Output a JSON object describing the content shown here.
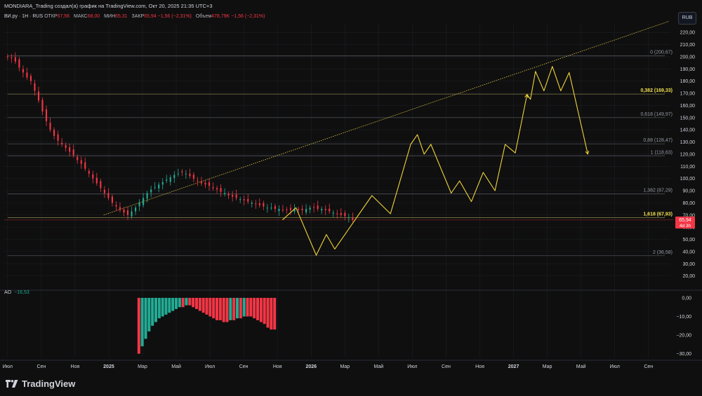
{
  "header": {
    "title": "MONDIARA_Trading создал(а) график на TradingView.com, Окт 20, 2025 21:35 UTC+3",
    "symbol": "ВИ.ру · 1Н · RUS",
    "open_label": "ОТКР",
    "open_value": "67,56",
    "high_label": "МАКС",
    "high_value": "68,00",
    "low_label": "МИН",
    "low_value": "65,31",
    "close_label": "ЗАКР",
    "close_value": "65,94 −1,56 (−2,31%)",
    "volume_label": "Объем",
    "volume_value": "478,79K −1,56 (−2,31%)"
  },
  "currency": "RUB",
  "price_tag": {
    "value": "65,94",
    "countdown": "4d 3h"
  },
  "ao": {
    "label": "AO",
    "value": "−16,53"
  },
  "footer": {
    "brand": "TradingView"
  },
  "colors": {
    "up": "#22ab94",
    "down": "#f23645",
    "projection": "#f0d43a",
    "background": "#0f0f0f"
  },
  "chart_data": {
    "type": "candlestick",
    "price_axis": {
      "ylim": [
        10,
        227
      ],
      "ticks": [
        220,
        210,
        200,
        190,
        180,
        170,
        160,
        150,
        140,
        130,
        120,
        110,
        100,
        90,
        80,
        70,
        60,
        50,
        40,
        30,
        20
      ],
      "tick_labels": [
        "220,00",
        "210,00",
        "200,00",
        "190,00",
        "180,00",
        "170,00",
        "160,00",
        "150,00",
        "140,00",
        "130,00",
        "120,00",
        "110,00",
        "100,00",
        "90,00",
        "80,00",
        "70,00",
        "60,00",
        "50,00",
        "40,00",
        "30,00",
        "20,00"
      ]
    },
    "time_axis": {
      "labels": [
        "Июл",
        "Сен",
        "Ноя",
        "2025",
        "Мар",
        "Май",
        "Июл",
        "Сен",
        "Ноя",
        "2026",
        "Мар",
        "Май",
        "Июл",
        "Сен",
        "Ноя",
        "2027",
        "Мар",
        "Май",
        "Июл",
        "Сен"
      ],
      "bold": [
        "2025",
        "2026",
        "2027"
      ],
      "positions": [
        0,
        2,
        4,
        6,
        8,
        10,
        12,
        14,
        16,
        18,
        20,
        22,
        24,
        26,
        28,
        30,
        32,
        34,
        36,
        38
      ],
      "xlim": [
        -0.2,
        39.3
      ]
    },
    "candles_weekly_close": [
      200,
      199,
      196,
      191,
      187,
      183,
      180,
      172,
      164,
      155,
      147,
      140,
      135,
      131,
      128,
      125,
      122,
      119,
      115,
      112,
      108,
      104,
      100,
      96,
      92,
      88,
      84,
      80,
      77,
      74,
      72,
      70,
      73,
      76,
      80,
      84,
      88,
      91,
      93,
      95,
      97,
      99,
      101,
      103,
      104,
      105,
      104,
      102,
      100,
      98,
      96,
      95,
      94,
      92,
      91,
      89,
      88,
      86,
      85,
      84,
      83,
      82,
      81,
      80,
      79,
      78,
      77,
      76,
      76,
      75,
      75,
      74,
      74,
      74,
      75,
      74,
      74,
      75,
      76,
      76,
      75,
      75,
      74,
      73,
      72,
      71,
      70,
      69,
      68,
      66
    ],
    "fibonacci": [
      {
        "label": "0 (200,67)",
        "value": 200.67
      },
      {
        "label": "0,382 (169,33)",
        "value": 169.33,
        "highlight": true
      },
      {
        "label": "0,618 (149,97)",
        "value": 149.97
      },
      {
        "label": "0,88 (128,47)",
        "value": 128.47
      },
      {
        "label": "1 (118,63)",
        "value": 118.63
      },
      {
        "label": "1,382 (87,29)",
        "value": 87.29
      },
      {
        "label": "1,618 (67,93)",
        "value": 67.93,
        "highlight": true
      },
      {
        "label": "2 (36,58)",
        "value": 36.58
      }
    ],
    "current_price": 65.94,
    "trendline": [
      {
        "x": 5.7,
        "y": 70
      },
      {
        "x": 39.2,
        "y": 229
      }
    ],
    "projection": [
      {
        "x": 16.3,
        "y": 66
      },
      {
        "x": 17.1,
        "y": 76
      },
      {
        "x": 18.3,
        "y": 37
      },
      {
        "x": 18.9,
        "y": 54
      },
      {
        "x": 19.4,
        "y": 42
      },
      {
        "x": 21.6,
        "y": 86
      },
      {
        "x": 22.7,
        "y": 71
      },
      {
        "x": 23.9,
        "y": 128
      },
      {
        "x": 24.3,
        "y": 136
      },
      {
        "x": 24.7,
        "y": 120
      },
      {
        "x": 25.1,
        "y": 128
      },
      {
        "x": 26.3,
        "y": 88
      },
      {
        "x": 26.8,
        "y": 98
      },
      {
        "x": 27.5,
        "y": 81
      },
      {
        "x": 28.2,
        "y": 105
      },
      {
        "x": 28.9,
        "y": 90
      },
      {
        "x": 29.5,
        "y": 128
      },
      {
        "x": 30.1,
        "y": 121
      },
      {
        "x": 30.8,
        "y": 169
      },
      {
        "x": 31.0,
        "y": 165
      },
      {
        "x": 31.3,
        "y": 188
      },
      {
        "x": 31.8,
        "y": 172
      },
      {
        "x": 32.3,
        "y": 192
      },
      {
        "x": 32.8,
        "y": 172
      },
      {
        "x": 33.3,
        "y": 187
      },
      {
        "x": 34.4,
        "y": 120
      }
    ],
    "ao_axis": {
      "ylim": [
        -32,
        3
      ],
      "ticks": [
        0,
        -10,
        -20,
        -30
      ],
      "tick_labels": [
        "0,00",
        "−10,00",
        "−20,00",
        "−30,00"
      ]
    },
    "ao_values": [
      -30,
      -26,
      -22,
      -18,
      -15,
      -13,
      -11,
      -10,
      -9,
      -8,
      -7,
      -6,
      -5,
      -5,
      -4,
      -4,
      -5,
      -6,
      -7,
      -8,
      -9,
      -10,
      -11,
      -12,
      -12,
      -13,
      -13,
      -12,
      -12,
      -11,
      -11,
      -10,
      -10,
      -10,
      -11,
      -12,
      -13,
      -14,
      -16,
      -17,
      -17
    ],
    "ao_start_x": 7.7,
    "ao_end_x": 15.95
  }
}
